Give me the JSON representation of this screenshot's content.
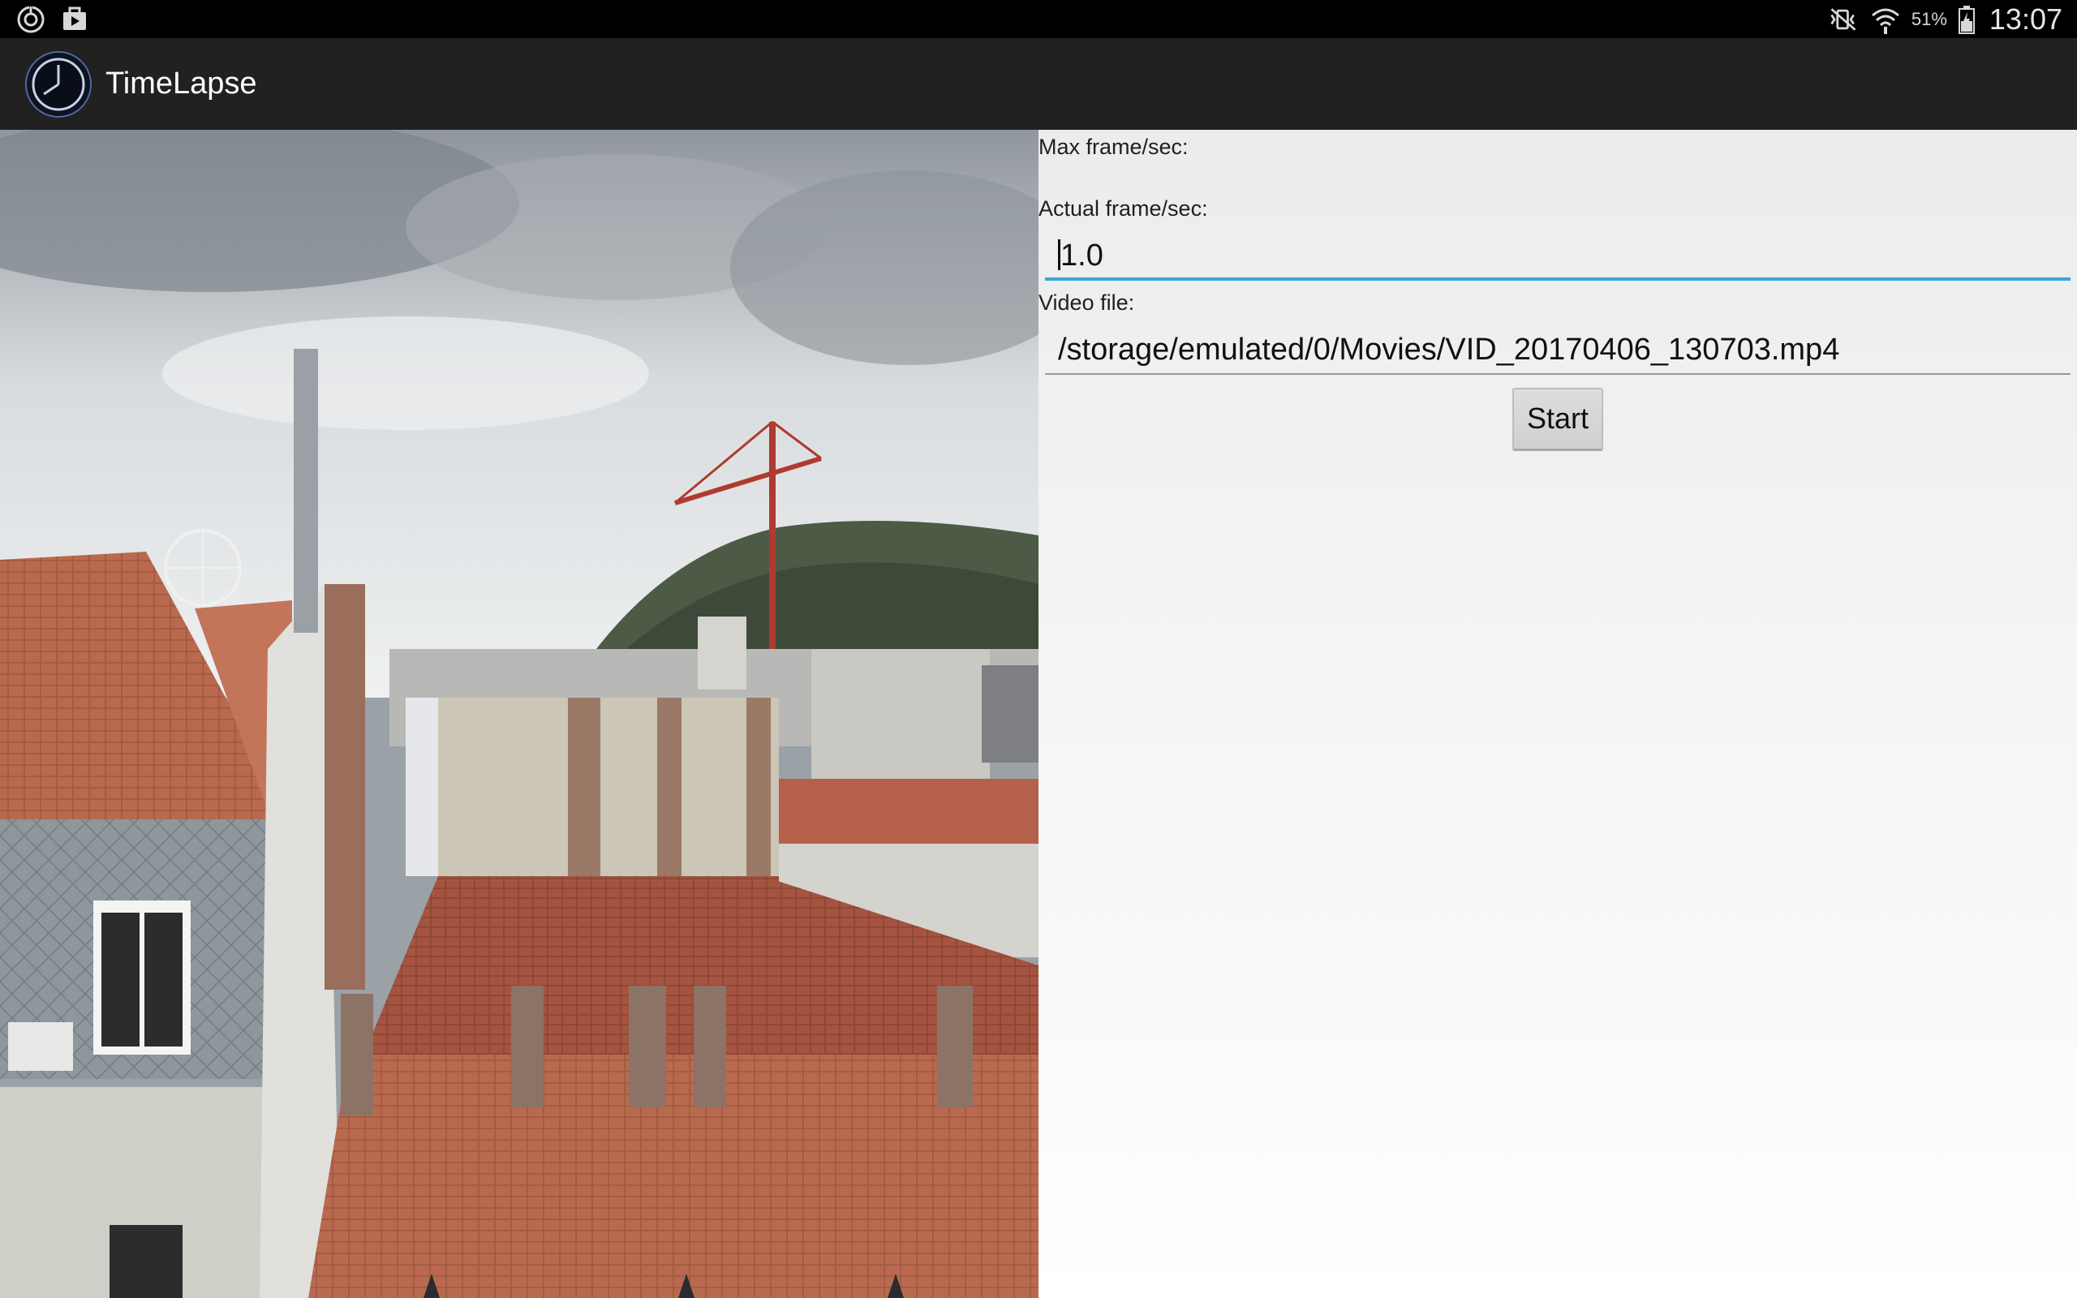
{
  "status_bar": {
    "left_icons": [
      "sync-icon",
      "notification-bag-icon"
    ],
    "right_icons": [
      "mute-vibrate-icon",
      "wifi-icon",
      "battery-icon"
    ],
    "battery_percent": "51%",
    "time": "13:07"
  },
  "action_bar": {
    "app_icon": "timelapse-clock-icon",
    "title": "TimeLapse"
  },
  "form": {
    "max_fps_label": "Max frame/sec:",
    "actual_fps_label": "Actual frame/sec:",
    "actual_fps_value": "1.0",
    "video_file_label": "Video file:",
    "video_file_value": "/storage/emulated/0/Movies/VID_20170406_130703.mp4",
    "start_label": "Start"
  },
  "colors": {
    "status_bar": "#000000",
    "action_bar": "#212121",
    "focus_underline": "#33a8d8"
  }
}
